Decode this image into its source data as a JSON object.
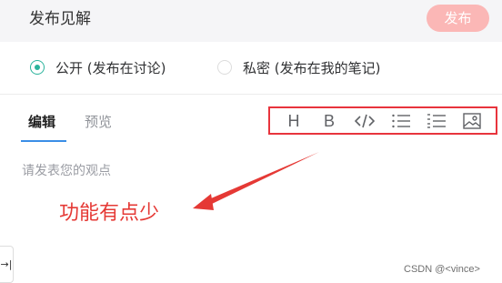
{
  "header": {
    "title": "发布见解",
    "publish_label": "发布"
  },
  "visibility": {
    "public_label": "公开 (发布在讨论)",
    "private_label": "私密 (发布在我的笔记)",
    "selected": "public"
  },
  "tabs": {
    "edit_label": "编辑",
    "preview_label": "预览",
    "active": "edit"
  },
  "toolbar": {
    "items": [
      "heading-icon",
      "bold-icon",
      "code-icon",
      "unordered-list-icon",
      "ordered-list-icon",
      "image-icon"
    ],
    "heading_glyph": "H",
    "bold_glyph": "B"
  },
  "editor": {
    "placeholder": "请发表您的观点"
  },
  "annotation": {
    "text": "功能有点少"
  },
  "side_tab": {
    "glyph": "→|"
  },
  "watermark": {
    "text": "CSDN @<vince>"
  },
  "colors": {
    "accent": "#2bb39c",
    "publish_button": "#fbb7b6",
    "annotation": "#e53935",
    "tab_underline": "#3a8ee6"
  }
}
